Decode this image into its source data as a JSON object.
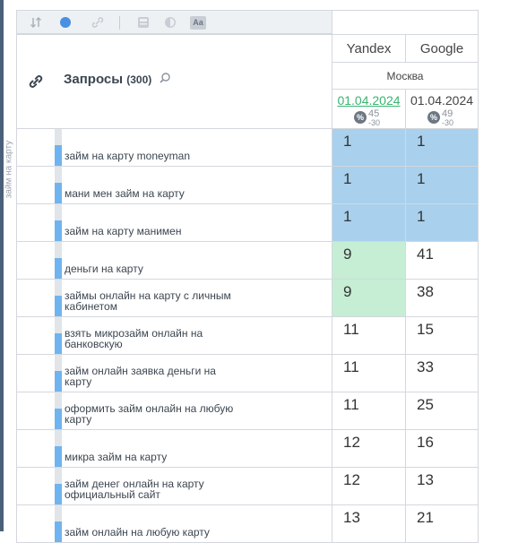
{
  "sidebar": {
    "label": "займ на карту"
  },
  "header": {
    "queries_label": "Запросы",
    "queries_count": "(300)",
    "engines": [
      "Yandex",
      "Google"
    ],
    "region": "Москва",
    "yandex_date": "01.04.2024",
    "google_date": "01.04.2024",
    "yandex_badge": {
      "icon": "%",
      "value": "45",
      "sub": "-30"
    },
    "google_badge": {
      "icon": "%",
      "value": "49",
      "sub": "-30"
    }
  },
  "rows": [
    {
      "query_line1": "займ на карту moneyman",
      "query_line2": "",
      "yandex": "1",
      "google": "1",
      "bar": 0.55,
      "yandex_state": "top",
      "google_state": "top"
    },
    {
      "query_line1": "мани мен займ на карту",
      "query_line2": "",
      "yandex": "1",
      "google": "1",
      "bar": 0.55,
      "yandex_state": "top",
      "google_state": "top"
    },
    {
      "query_line1": "займ на карту манимен",
      "query_line2": "",
      "yandex": "1",
      "google": "1",
      "bar": 0.55,
      "yandex_state": "top",
      "google_state": "top"
    },
    {
      "query_line1": "деньги на карту",
      "query_line2": "",
      "yandex": "9",
      "google": "41",
      "bar": 0.55,
      "yandex_state": "good",
      "google_state": "none"
    },
    {
      "query_line1": "займы онлайн на карту с личным",
      "query_line2": "кабинетом",
      "yandex": "9",
      "google": "38",
      "bar": 0.55,
      "yandex_state": "good",
      "google_state": "none"
    },
    {
      "query_line1": "взять микрозайм онлайн на",
      "query_line2": "банковскую",
      "yandex": "11",
      "google": "15",
      "bar": 0.55,
      "yandex_state": "none",
      "google_state": "none"
    },
    {
      "query_line1": "займ онлайн заявка деньги на",
      "query_line2": "карту",
      "yandex": "11",
      "google": "33",
      "bar": 0.55,
      "yandex_state": "none",
      "google_state": "none"
    },
    {
      "query_line1": "оформить займ онлайн на любую",
      "query_line2": "карту",
      "yandex": "11",
      "google": "25",
      "bar": 0.55,
      "yandex_state": "none",
      "google_state": "none"
    },
    {
      "query_line1": "микра займ на карту",
      "query_line2": "",
      "yandex": "12",
      "google": "16",
      "bar": 0.55,
      "yandex_state": "none",
      "google_state": "none"
    },
    {
      "query_line1": "займ денег онлайн на карту",
      "query_line2": "официальный сайт",
      "yandex": "12",
      "google": "13",
      "bar": 0.55,
      "yandex_state": "none",
      "google_state": "none"
    },
    {
      "query_line1": "займ онлайн на любую карту",
      "query_line2": "",
      "yandex": "13",
      "google": "21",
      "bar": 0.55,
      "yandex_state": "none",
      "google_state": "none"
    }
  ],
  "colors": {
    "top": "#a9d0ed",
    "good": "#c5eed5",
    "none": "#ffffff",
    "bar": "#6fb4ef",
    "accent": "#4a90e2"
  },
  "icons": [
    "sort-icon",
    "color-dot-icon",
    "link-icon",
    "calculator-icon",
    "contrast-icon",
    "font-size-icon",
    "search-icon",
    "link-chain-icon",
    "percent-icon"
  ]
}
